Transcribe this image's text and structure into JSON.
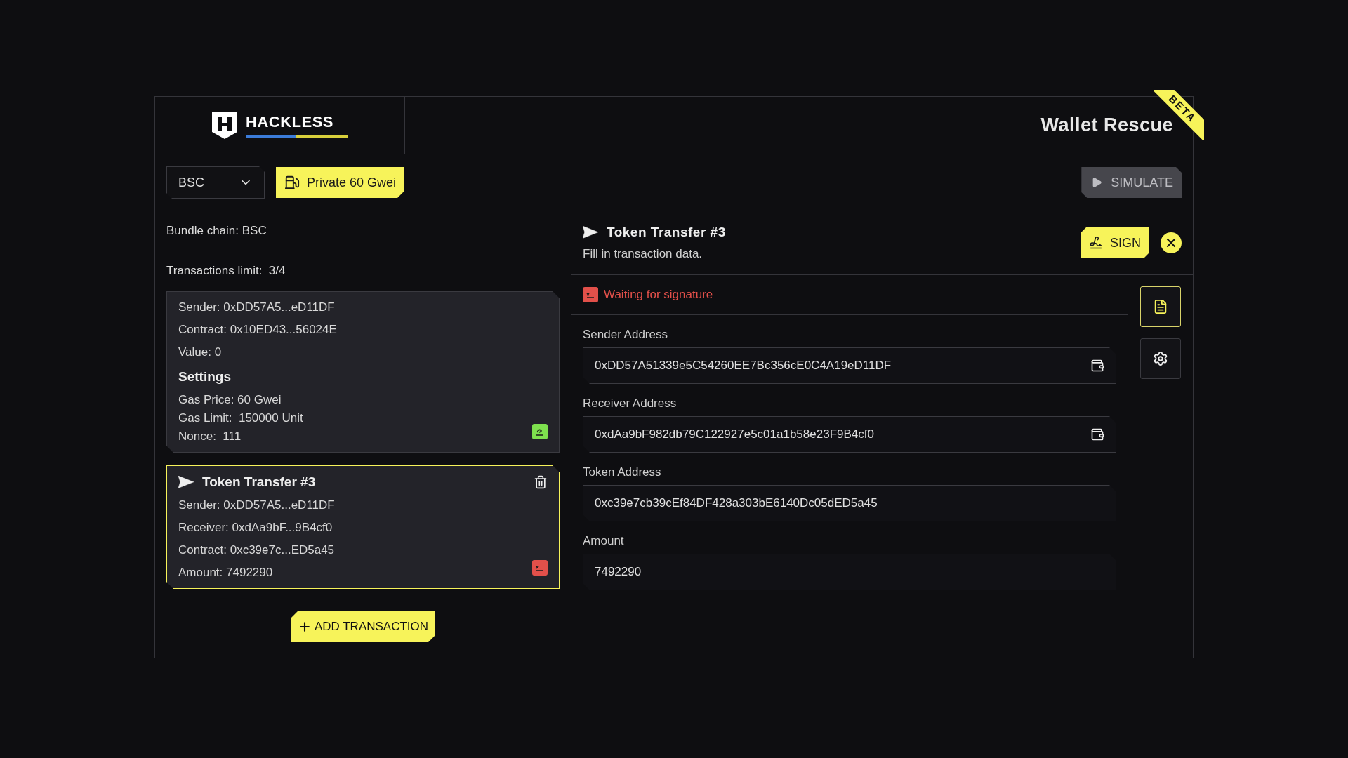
{
  "brand": {
    "name": "HACKLESS"
  },
  "app_title": "Wallet Rescue",
  "badge": "BETA",
  "toolbar": {
    "chain": "BSC",
    "gas_button": "Private 60 Gwei",
    "simulate_button": {
      "label": "SIMULATE",
      "disabled": true
    }
  },
  "bundle": {
    "chain_label": "Bundle chain: BSC",
    "limit_label": "Transactions limit:",
    "limit_value": "3/4"
  },
  "transactions": [
    {
      "selected": false,
      "signed": true,
      "lines": [
        "Sender: 0xDD57A5...eD11DF",
        "Contract: 0x10ED43...56024E",
        "Value: 0"
      ],
      "settings_title": "Settings",
      "settings": [
        "Gas Price: 60 Gwei",
        "Gas Limit:  150000 Unit",
        "Nonce:  111"
      ]
    },
    {
      "selected": true,
      "signed": false,
      "title": "Token Transfer #3",
      "lines": [
        "Sender: 0xDD57A5...eD11DF",
        "Receiver: 0xdAa9bF...9B4cf0",
        "Contract: 0xc39e7c...ED5a45",
        "Amount: 7492290"
      ]
    }
  ],
  "add_button": "ADD TRANSACTION",
  "detail": {
    "title": "Token Transfer #3",
    "subtitle": "Fill in transaction data.",
    "sign_button": "SIGN",
    "status": {
      "signed": false,
      "text": "Waiting for signature"
    },
    "fields": [
      {
        "label": "Sender Address",
        "value": "0xDD57A51339e5C54260EE7Bc356cE0C4A19eD11DF",
        "wallet_button": true
      },
      {
        "label": "Receiver Address",
        "value": "0xdAa9bF982db79C122927e5c01a1b58e23F9B4cf0",
        "wallet_button": true
      },
      {
        "label": "Token Address",
        "value": "0xc39e7cb39cEf84DF428a303bE6140Dc05dED5a45",
        "wallet_button": false
      },
      {
        "label": "Amount",
        "value": "7492290",
        "wallet_button": false
      }
    ]
  },
  "side_rail": [
    {
      "kind": "document",
      "selected": true
    },
    {
      "kind": "settings",
      "selected": false
    }
  ]
}
